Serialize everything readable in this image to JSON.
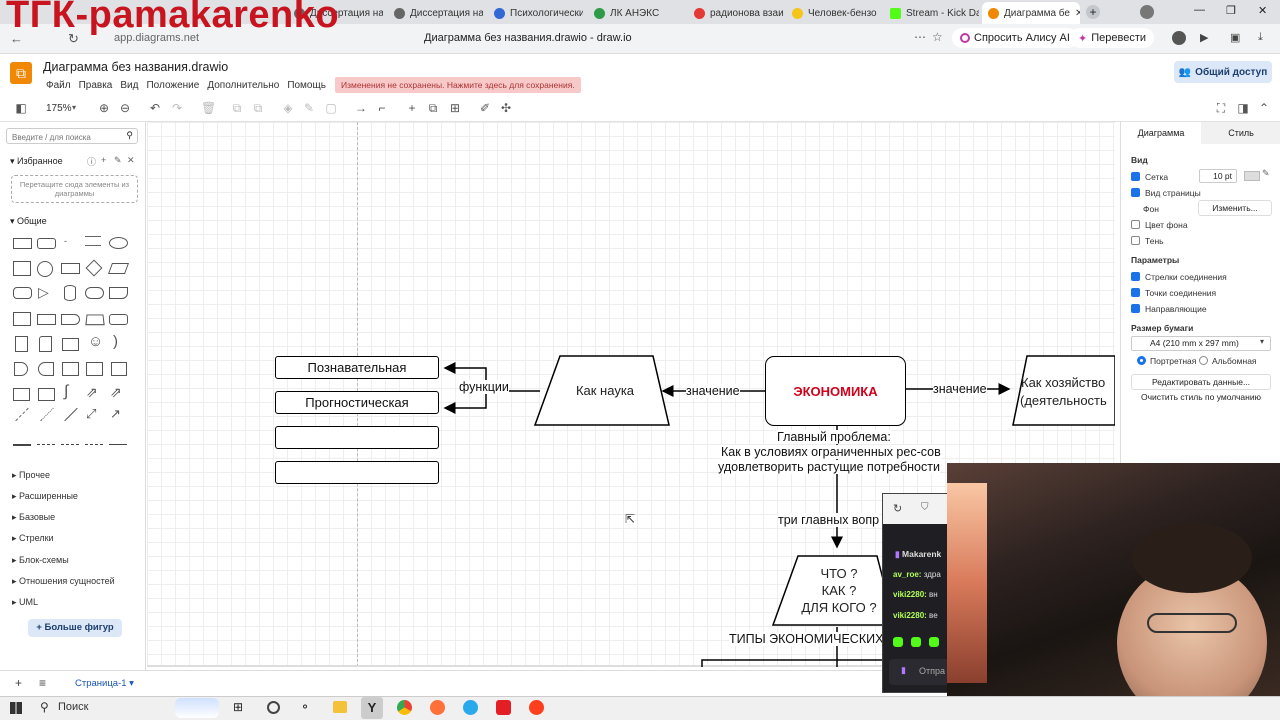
{
  "watermark": "TГК-pamakarenko",
  "browser": {
    "tabs": [
      {
        "label": "Диссертация на"
      },
      {
        "label": "Психологически"
      },
      {
        "label": "ЛК АНЭКС"
      },
      {
        "label": "радионова взаи"
      },
      {
        "label": "Человек-бензо"
      },
      {
        "label": "Stream - Kick Das"
      },
      {
        "label": "Диаграмма бе"
      }
    ],
    "url": "app.diagrams.net",
    "page_title": "Диаграмма без названия.drawio - draw.io",
    "alice_label": "Спросить Алису AI",
    "translate_label": "Перевести"
  },
  "app": {
    "file_title": "Диаграмма без названия.drawio",
    "menu": [
      "Файл",
      "Правка",
      "Вид",
      "Положение",
      "Дополнительно",
      "Помощь"
    ],
    "unsaved_notice": "Изменения не сохранены. Нажмите здесь для сохранения.",
    "share_label": "Общий доступ",
    "zoom": "175%"
  },
  "left_panel": {
    "search_placeholder": "Введите / для поиска",
    "favorites_label": "Избранное",
    "drop_hint": "Перетащите сюда элементы из диаграммы",
    "general_label": "Общие",
    "categories": [
      "Прочее",
      "Расширенные",
      "Базовые",
      "Стрелки",
      "Блок-схемы",
      "Отношения сущностей",
      "UML"
    ],
    "more_shapes": "Больше фигур"
  },
  "right_panel": {
    "tab_diagram": "Диаграмма",
    "tab_style": "Стиль",
    "view_label": "Вид",
    "grid_label": "Сетка",
    "grid_size": "10 pt",
    "page_view_label": "Вид страницы",
    "background_label": "Фон",
    "change_button": "Изменить...",
    "bg_color_label": "Цвет фона",
    "shadow_label": "Тень",
    "params_label": "Параметры",
    "connection_arrows": "Стрелки соединения",
    "connection_points": "Точки соединения",
    "guides": "Направляющие",
    "paper_size_label": "Размер бумаги",
    "paper_size": "A4 (210 mm x 297 mm)",
    "portrait": "Портретная",
    "landscape": "Альбомная",
    "edit_data": "Редактировать данные...",
    "clear_style": "Очистить стиль по умолчанию"
  },
  "diagram": {
    "box1": "Познавательная",
    "box2": "Прогностическая",
    "functions_label": "функции",
    "science": "Как наука",
    "meaning1": "значение",
    "economy": "ЭКОНОМИКА",
    "meaning2": "значение",
    "household_line1": "Как хозяйство",
    "household_line2": "(деятельность",
    "problem_line1": "Главный проблема:",
    "problem_line2": "Как в условиях ограниченных рес-сов",
    "problem_line3": "удовлетворить растущие потребности",
    "three_questions": "три главных вопр",
    "q1": "ЧТО ?",
    "q2": "КАК ?",
    "q3": "ДЛЯ КОГО ?",
    "types": "ТИПЫ ЭКОНОМИЧЕСКИХ"
  },
  "chat": {
    "user1": "Makarenk",
    "user2": "av_roe:",
    "msg2": "здра",
    "user3": "viki2280:",
    "msg3": "вн",
    "user4": "viki2280:",
    "msg4": "ве",
    "send": "Отпра"
  },
  "bottom": {
    "page_tab": "Страница-1"
  },
  "taskbar": {
    "search": "Поиск"
  },
  "colors": {
    "economy_red": "#d0021b",
    "accent": "#1a73e8"
  }
}
